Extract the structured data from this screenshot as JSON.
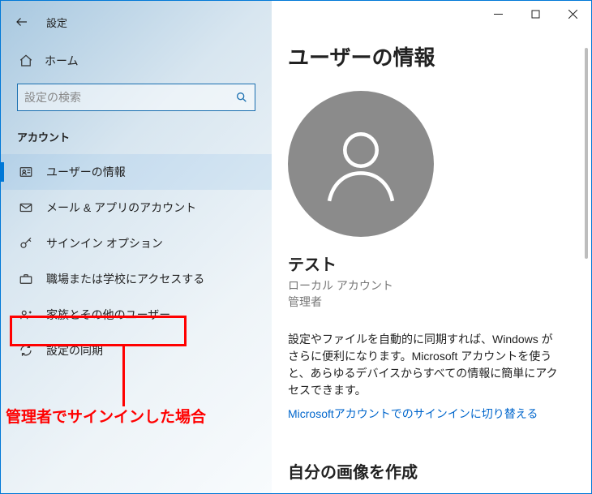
{
  "window": {
    "title": "設定"
  },
  "sidebar": {
    "home": "ホーム",
    "search_placeholder": "設定の検索",
    "section": "アカウント",
    "items": [
      {
        "icon": "user-card-icon",
        "label": "ユーザーの情報"
      },
      {
        "icon": "mail-icon",
        "label": "メール & アプリのアカウント"
      },
      {
        "icon": "key-icon",
        "label": "サインイン オプション"
      },
      {
        "icon": "briefcase-icon",
        "label": "職場または学校にアクセスする"
      },
      {
        "icon": "family-icon",
        "label": "家族とその他のユーザー"
      },
      {
        "icon": "sync-icon",
        "label": "設定の同期"
      }
    ]
  },
  "annotation": {
    "text": "管理者でサインインした場合"
  },
  "main": {
    "page_title": "ユーザーの情報",
    "username": "テスト",
    "account_type": "ローカル アカウント",
    "account_role": "管理者",
    "description": "設定やファイルを自動的に同期すれば、Windows がさらに便利になります。Microsoft アカウントを使うと、あらゆるデバイスからすべての情報に簡単にアクセスできます。",
    "link": "Microsoftアカウントでのサインインに切り替える",
    "subheading": "自分の画像を作成"
  }
}
